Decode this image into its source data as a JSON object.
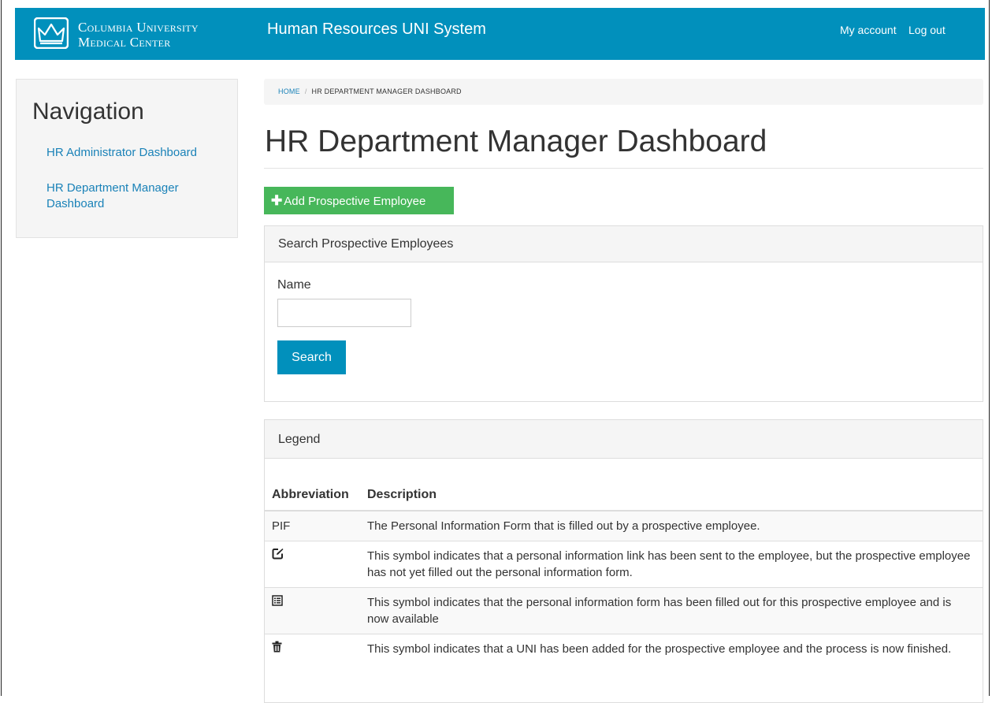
{
  "header": {
    "brand_line1": "Columbia University",
    "brand_line2": "Medical Center",
    "app_title": "Human Resources UNI System",
    "my_account": "My account",
    "log_out": "Log out"
  },
  "sidebar": {
    "title": "Navigation",
    "items": [
      {
        "label": "HR Administrator Dashboard"
      },
      {
        "label": "HR Department Manager Dashboard"
      }
    ]
  },
  "breadcrumb": {
    "home": "HOME",
    "separator": "/",
    "current": "HR DEPARTMENT MANAGER DASHBOARD"
  },
  "page": {
    "title": "HR Department Manager Dashboard",
    "add_button": "Add Prospective Employee"
  },
  "search_panel": {
    "title": "Search Prospective Employees",
    "name_label": "Name",
    "name_value": "",
    "search_button": "Search"
  },
  "legend": {
    "title": "Legend",
    "columns": [
      "Abbreviation",
      "Description"
    ],
    "rows": [
      {
        "abbr": "PIF",
        "icon": "",
        "description": "The Personal Information Form that is filled out by a prospective employee."
      },
      {
        "abbr": "",
        "icon": "edit-square-icon",
        "description": "This symbol indicates that a personal information link has been sent to the employee, but the prospective employee has not yet filled out the personal information form."
      },
      {
        "abbr": "",
        "icon": "list-form-icon",
        "description": "This symbol indicates that the personal information form has been filled out for this prospective employee and is now available"
      },
      {
        "abbr": "",
        "icon": "trash-icon",
        "description": "This symbol indicates that a UNI has been added for the prospective employee and the process is now finished."
      }
    ]
  },
  "colors": {
    "navbar": "#0190bc",
    "link": "#1a82b8",
    "add_button": "#47b75a",
    "search_button": "#0190bc"
  }
}
